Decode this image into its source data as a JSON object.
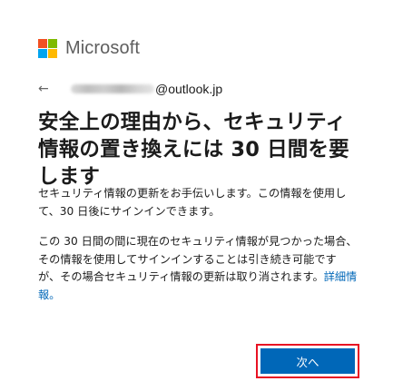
{
  "header": {
    "brand_name": "Microsoft",
    "logo_colors": [
      "#f25022",
      "#7fba00",
      "#00a4ef",
      "#ffb900"
    ]
  },
  "identity": {
    "back_icon": "back-arrow-icon",
    "email_domain": "@outlook.jp"
  },
  "main": {
    "title": "安全上の理由から、セキュリティ情報の置き換えには 30 日間を要します",
    "paragraph1": "セキュリティ情報の更新をお手伝いします。この情報を使用して、30 日後にサインインできます。",
    "paragraph2": "この 30 日間の間に現在のセキュリティ情報が見つかった場合、その情報を使用してサインインすることは引き続き可能ですが、その場合セキュリティ情報の更新は取り消されます。",
    "learn_more_link": "詳細情報。"
  },
  "footer": {
    "next_label": "次へ",
    "accent_color": "#0067b8",
    "highlight_color": "#e81123"
  }
}
